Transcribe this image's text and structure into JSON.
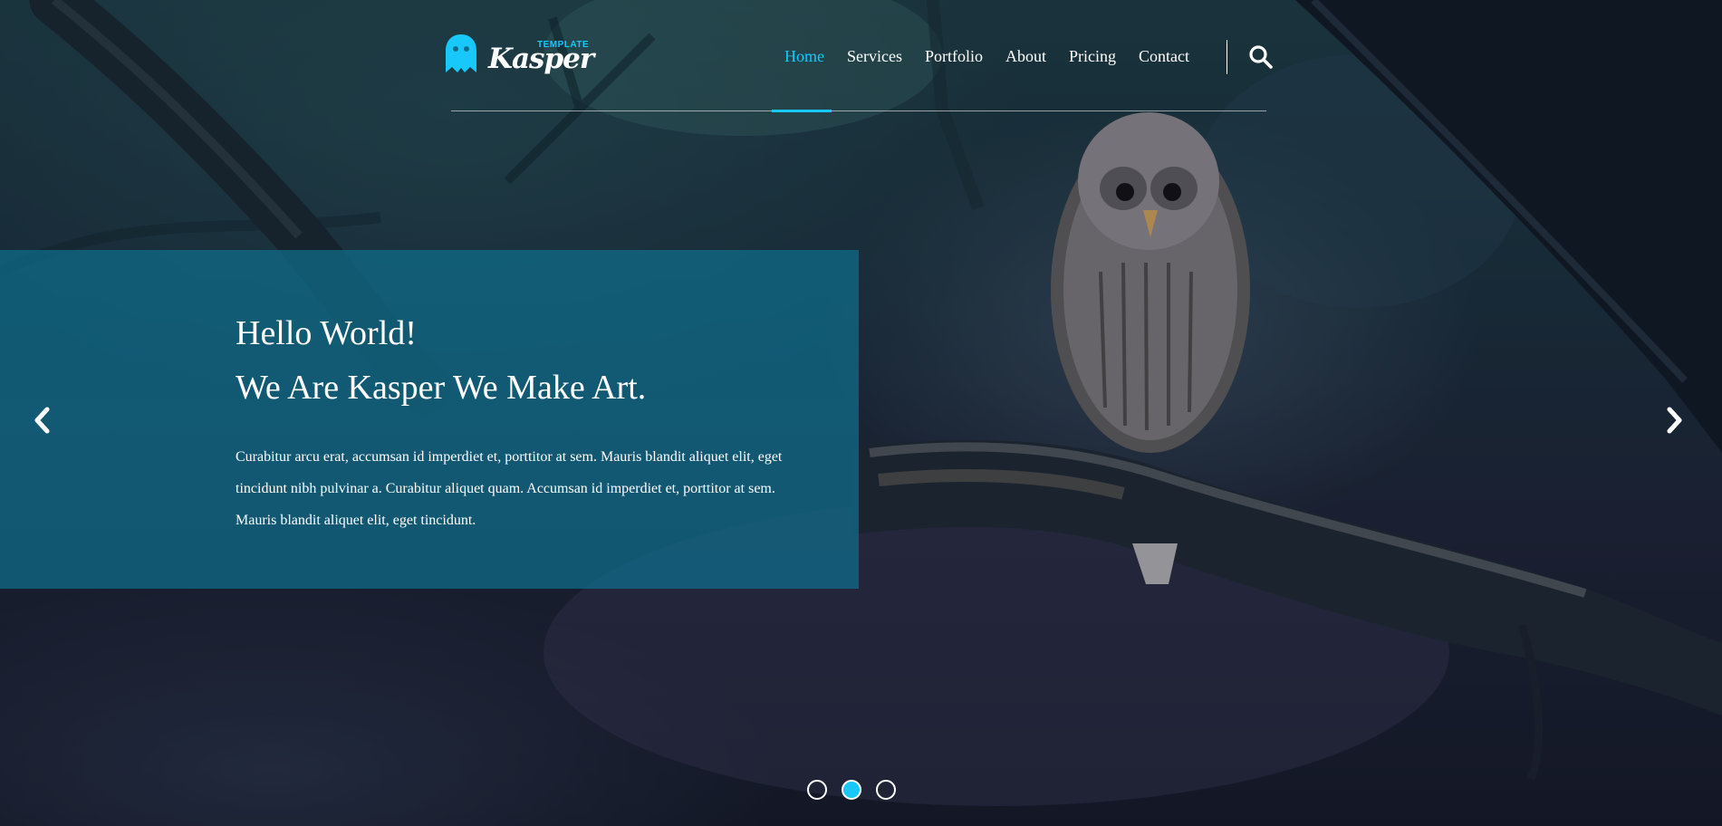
{
  "brand": {
    "name": "Kasper",
    "tagline": "TEMPLATE",
    "accent_color": "#19c8fa"
  },
  "nav": {
    "items": [
      {
        "label": "Home",
        "active": true
      },
      {
        "label": "Services",
        "active": false
      },
      {
        "label": "Portfolio",
        "active": false
      },
      {
        "label": "About",
        "active": false
      },
      {
        "label": "Pricing",
        "active": false
      },
      {
        "label": "Contact",
        "active": false
      }
    ],
    "search_icon": "search-icon"
  },
  "hero": {
    "heading_line1": "Hello World!",
    "heading_line2": "We Are Kasper We Make Art.",
    "description": "Curabitur arcu erat, accumsan id imperdiet et, porttitor at sem. Mauris blandit aliquet elit, eget tincidunt nibh pulvinar a. Curabitur aliquet quam. Accumsan id imperdiet et, porttitor at sem. Mauris blandit aliquet elit, eget tincidunt.",
    "panel_color": "#0f6e8c",
    "background_image": "owl perched on tree branch in dark forest"
  },
  "slider": {
    "prev_icon": "chevron-left-icon",
    "next_icon": "chevron-right-icon",
    "slide_count": 3,
    "active_slide": 2
  }
}
